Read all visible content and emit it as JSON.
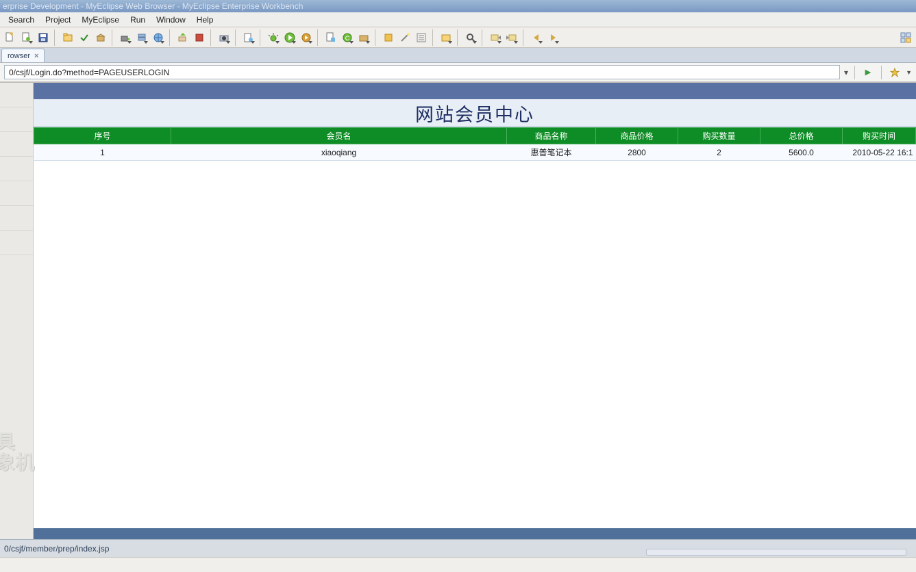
{
  "window": {
    "title": "erprise Development - MyEclipse Web Browser - MyEclipse Enterprise Workbench"
  },
  "menu": {
    "items": [
      "Search",
      "Project",
      "MyEclipse",
      "Run",
      "Window",
      "Help"
    ]
  },
  "tab": {
    "label": "rowser",
    "close": "×"
  },
  "address": {
    "value": "0/csjf/Login.do?method=PAGEUSERLOGIN",
    "dropdown_hint": "▾"
  },
  "page": {
    "title": "网站会员中心"
  },
  "table": {
    "headers": [
      "序号",
      "会员名",
      "商品名称",
      "商品价格",
      "购买数量",
      "总价格",
      "购买时间"
    ],
    "rows": [
      {
        "seq": "1",
        "member": "xiaoqiang",
        "product": "惠普笔记本",
        "price": "2800",
        "qty": "2",
        "total": "5600.0",
        "time": "2010-05-22 16:1"
      }
    ]
  },
  "status": {
    "text": "0/csjf/member/prep/index.jsp"
  },
  "watermark": {
    "line1": "具",
    "line2": "象机"
  }
}
